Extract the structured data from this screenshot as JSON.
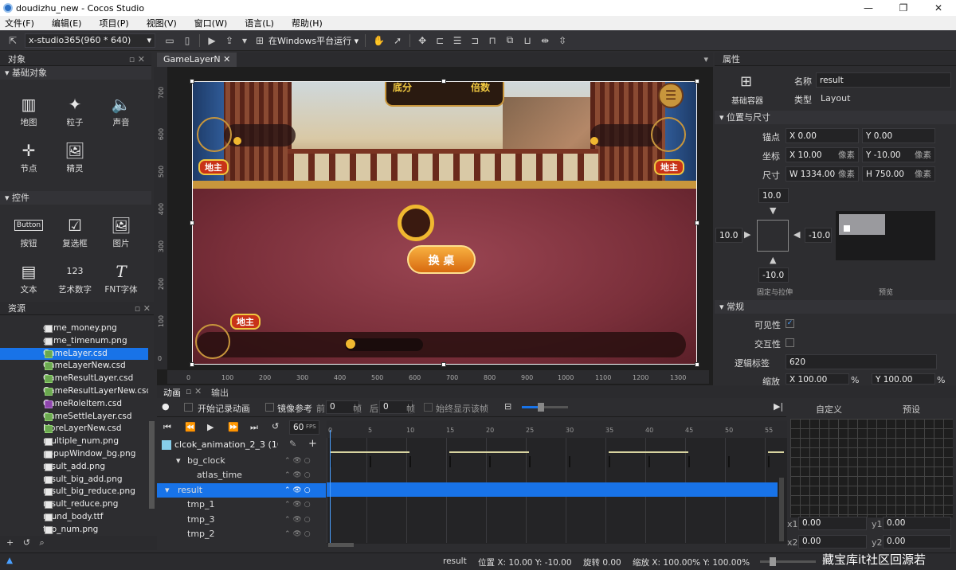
{
  "window": {
    "title": "doudizhu_new - Cocos Studio",
    "minimize": "—",
    "maximize": "❐",
    "close": "✕"
  },
  "menu": [
    "文件(F)",
    "编辑(E)",
    "项目(P)",
    "视图(V)",
    "窗口(W)",
    "语言(L)",
    "帮助(H)"
  ],
  "toolbar": {
    "resolution": "x-studio365(960 * 640)",
    "run_target": "在Windows平台运行"
  },
  "objects_panel": {
    "title": "对象",
    "basic_header": "基础对象",
    "basic": [
      {
        "label": "地图",
        "icon": "map-icon"
      },
      {
        "label": "粒子",
        "icon": "particle-icon"
      },
      {
        "label": "声音",
        "icon": "sound-icon"
      },
      {
        "label": "节点",
        "icon": "node-icon"
      },
      {
        "label": "精灵",
        "icon": "sprite-icon"
      }
    ],
    "controls_header": "控件",
    "controls": [
      {
        "label": "按钮",
        "icon": "button-icon"
      },
      {
        "label": "复选框",
        "icon": "checkbox-icon"
      },
      {
        "label": "图片",
        "icon": "image-icon"
      },
      {
        "label": "文本",
        "icon": "text-icon"
      },
      {
        "label": "艺术数字",
        "icon": "art-number-icon"
      },
      {
        "label": "FNT字体",
        "icon": "fnt-font-icon"
      }
    ]
  },
  "resources_panel": {
    "title": "资源",
    "items": [
      {
        "name": "game_money.png",
        "type": "png"
      },
      {
        "name": "game_timenum.png",
        "type": "png"
      },
      {
        "name": "GameLayer.csd",
        "type": "csd",
        "selected": true
      },
      {
        "name": "GameLayerNew.csd",
        "type": "csd"
      },
      {
        "name": "GameResultLayer.csd",
        "type": "csd"
      },
      {
        "name": "GameResultLayerNew.csd",
        "type": "csd"
      },
      {
        "name": "GameRoleItem.csd",
        "type": "csd2"
      },
      {
        "name": "GameSettleLayer.csd",
        "type": "csd"
      },
      {
        "name": "MoreLayerNew.csd",
        "type": "csd"
      },
      {
        "name": "multiple_num.png",
        "type": "png"
      },
      {
        "name": "popupWindow_bg.png",
        "type": "png"
      },
      {
        "name": "result_add.png",
        "type": "png"
      },
      {
        "name": "result_big_add.png",
        "type": "png"
      },
      {
        "name": "result_big_reduce.png",
        "type": "png"
      },
      {
        "name": "result_reduce.png",
        "type": "png"
      },
      {
        "name": "round_body.ttf",
        "type": "png"
      },
      {
        "name": "top_num.png",
        "type": "png"
      }
    ]
  },
  "canvas": {
    "tab": "GameLayerN",
    "texts": {
      "base": "底分",
      "multiple": "倍数",
      "landlord": "地主",
      "change_table": "换 桌"
    },
    "ruler_x": [
      "0",
      "100",
      "200",
      "300",
      "400",
      "500",
      "600",
      "700",
      "800",
      "900",
      "1000",
      "1100",
      "1200",
      "1300"
    ],
    "ruler_y": [
      "700",
      "600",
      "500",
      "400",
      "300",
      "200",
      "100",
      "0"
    ]
  },
  "properties": {
    "title": "属性",
    "container_label": "基础容器",
    "name_label": "名称",
    "name_value": "result",
    "type_label": "类型",
    "type_value": "Layout",
    "pos_section": "位置与尺寸",
    "anchor_label": "锚点",
    "anchor_x": "X  0.00",
    "anchor_y": "Y  0.00",
    "pos_label": "坐标",
    "pos_x": "X  10.00",
    "pos_x_unit": "像素",
    "pos_y": "Y  -10.00",
    "pos_y_unit": "像素",
    "size_label": "尺寸",
    "size_w": "W  1334.00",
    "size_w_unit": "像素",
    "size_h": "H  750.00",
    "size_h_unit": "像素",
    "margin_top": "10.0",
    "margin_left": "10.0",
    "margin_right": "-10.0",
    "margin_bottom": "-10.0",
    "fix_label": "固定与拉伸",
    "preview_label": "预览",
    "general_section": "常规",
    "visible_label": "可见性",
    "visible": true,
    "interactive_label": "交互性",
    "interactive": false,
    "tag_label": "逻辑标签",
    "tag_value": "620",
    "scale_label": "缩放",
    "scale_x": "X  100.00",
    "scale_y": "Y  100.00",
    "pct": "%"
  },
  "timeline": {
    "tabs": [
      "动画",
      "输出"
    ],
    "record_label": "开始记录动画",
    "mirror_label": "镜像参考",
    "prev_label": "前",
    "prev_val": "0",
    "frame_unit": "帧",
    "next_label": "后",
    "next_val": "0",
    "always_show_label": "始终显示该帧",
    "fps": "60",
    "fps_unit": "FPS",
    "animation": "clcok_animation_2_3 (10",
    "custom_tab": "自定义",
    "preset_tab": "预设",
    "ruler": [
      "0",
      "5",
      "10",
      "15",
      "20",
      "25",
      "30",
      "35",
      "40",
      "45",
      "50",
      "55"
    ],
    "tree": [
      {
        "name": "bg_clock",
        "indent": 1,
        "expanded": true
      },
      {
        "name": "atlas_time",
        "indent": 2
      },
      {
        "name": "result",
        "indent": 0,
        "selected": true,
        "expanded": true
      },
      {
        "name": "tmp_1",
        "indent": 1
      },
      {
        "name": "tmp_3",
        "indent": 1
      },
      {
        "name": "tmp_2",
        "indent": 1
      }
    ],
    "curve": {
      "x1": "0.00",
      "y1": "0.00",
      "x2": "0.00",
      "y2": "0.00",
      "x1_label": "x1",
      "y1_label": "y1",
      "x2_label": "x2",
      "y2_label": "y2"
    }
  },
  "status": {
    "node": "result",
    "position": "位置 X: 10.00   Y: -10.00",
    "rotation": "旋转 0.00",
    "scale": "缩放 X: 100.00%   Y: 100.00%"
  },
  "watermark": "藏宝库it社区回源若",
  "colors": {
    "accent": "#1873e8",
    "table_felt": "#7a2f3a",
    "gold": "#f0b830"
  }
}
